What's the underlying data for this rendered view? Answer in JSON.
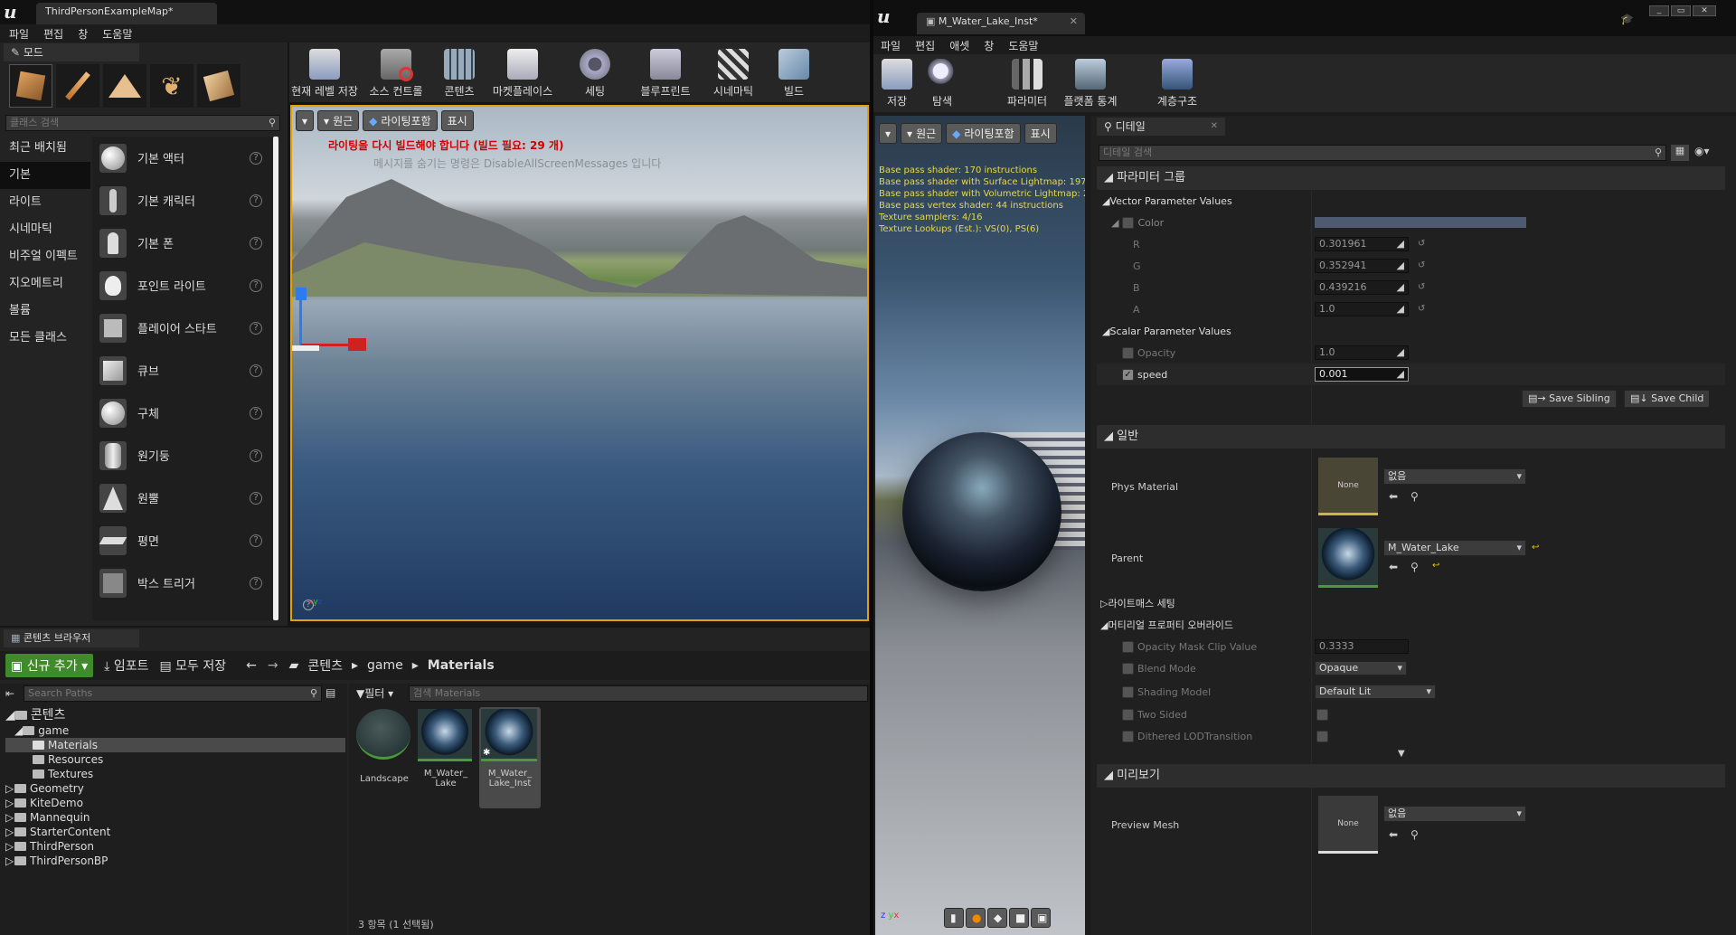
{
  "left_window": {
    "tab_title": "ThirdPersonExampleMap*",
    "menu": [
      "파일",
      "편집",
      "창",
      "도움말"
    ],
    "modes_tab": "모드",
    "toolbar": [
      "현재 레벨 저장",
      "소스 컨트롤",
      "콘텐츠",
      "마켓플레이스",
      "세팅",
      "블루프린트",
      "시네마틱",
      "빌드"
    ],
    "search_placeholder": "클래스 검색",
    "categories": [
      "최근 배치됨",
      "기본",
      "라이트",
      "시네마틱",
      "비주얼 이펙트",
      "지오메트리",
      "볼륨",
      "모든 클래스"
    ],
    "place_items": [
      "기본 액터",
      "기본 캐릭터",
      "기본 폰",
      "포인트 라이트",
      "플레이어 스타트",
      "큐브",
      "구체",
      "원기둥",
      "원뿔",
      "평면",
      "박스 트리거"
    ],
    "viewport": {
      "buttons": [
        "원근",
        "라이팅포함",
        "표시"
      ],
      "warning": "라이팅을 다시 빌드해야 합니다 (빌드 필요: 29 개)",
      "hint": "메시지를 숨기는 명령은 DisableAllScreenMessages 입니다"
    },
    "content_browser": {
      "tab": "콘텐츠 브라우저",
      "add_new": "신규 추가",
      "import": "임포트",
      "save_all": "모두 저장",
      "breadcrumb": [
        "콘텐츠",
        "game",
        "Materials"
      ],
      "search_paths_placeholder": "Search Paths",
      "filter": "필터",
      "search_assets_placeholder": "검색 Materials",
      "tree": [
        {
          "label": "콘텐츠",
          "level": 0
        },
        {
          "label": "game",
          "level": 1
        },
        {
          "label": "Materials",
          "level": 2
        },
        {
          "label": "Resources",
          "level": 2
        },
        {
          "label": "Textures",
          "level": 2
        },
        {
          "label": "Geometry",
          "level": 1
        },
        {
          "label": "KiteDemo",
          "level": 1
        },
        {
          "label": "Mannequin",
          "level": 1
        },
        {
          "label": "StarterContent",
          "level": 1
        },
        {
          "label": "ThirdPerson",
          "level": 1
        },
        {
          "label": "ThirdPersonBP",
          "level": 1
        }
      ],
      "assets": [
        "Landscape",
        "M_Water_ Lake",
        "M_Water_ Lake_Inst"
      ],
      "status": "3 항목 (1 선택됨)"
    }
  },
  "right_window": {
    "tab_title": "M_Water_Lake_Inst*",
    "menu": [
      "파일",
      "편집",
      "애셋",
      "창",
      "도움말"
    ],
    "toolbar": [
      "저장",
      "탐색",
      "파라미터",
      "플랫폼 통계",
      "계층구조"
    ],
    "viewport_buttons": [
      "원근",
      "라이팅포함",
      "표시"
    ],
    "stats": [
      "Base pass shader: 170 instructions",
      "Base pass shader with Surface Lightmap: 197",
      "Base pass shader with Volumetric Lightmap: 2",
      "Base pass vertex shader: 44 instructions",
      "Texture samplers: 4/16",
      "Texture Lookups (Est.): VS(0), PS(6)"
    ],
    "details": {
      "tab": "디테일",
      "search_placeholder": "디테일 검색",
      "param_group": "파라미터 그룹",
      "vector_params": "Vector Parameter Values",
      "color_label": "Color",
      "color_hex": "#4d5a70",
      "r_label": "R",
      "r": "0.301961",
      "g_label": "G",
      "g": "0.352941",
      "b_label": "B",
      "b": "0.439216",
      "a_label": "A",
      "a": "1.0",
      "scalar_params": "Scalar Parameter Values",
      "opacity_label": "Opacity",
      "opacity": "1.0",
      "speed_label": "speed",
      "speed": "0.001",
      "save_sibling": "Save Sibling",
      "save_child": "Save Child",
      "general": "일반",
      "phys_material_label": "Phys Material",
      "none_thumb": "None",
      "phys_material_value": "없음",
      "parent_label": "Parent",
      "parent_value": "M_Water_Lake",
      "lightmass": "라이트매스 세팅",
      "override": "머티리얼 프로퍼티 오버라이드",
      "opacity_mask_label": "Opacity Mask Clip Value",
      "opacity_mask": "0.3333",
      "blend_mode_label": "Blend Mode",
      "blend_mode": "Opaque",
      "shading_model_label": "Shading Model",
      "shading_model": "Default Lit",
      "two_sided_label": "Two Sided",
      "dithered_label": "Dithered LODTransition",
      "preview": "미리보기",
      "preview_mesh_label": "Preview Mesh",
      "preview_mesh_value": "없음"
    }
  }
}
